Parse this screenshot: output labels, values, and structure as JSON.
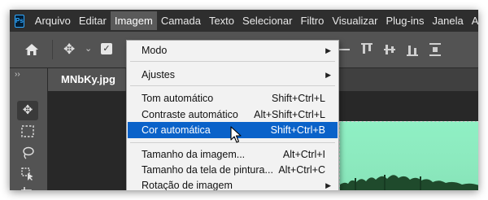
{
  "app": {
    "logo_text": "Ps"
  },
  "menubar": {
    "items": [
      "Arquivo",
      "Editar",
      "Imagem",
      "Camada",
      "Texto",
      "Selecionar",
      "Filtro",
      "Visualizar",
      "Plug-ins",
      "Janela",
      "Ajuda"
    ],
    "active_index": 2
  },
  "options_bar": {
    "checkbox_checked": true
  },
  "document": {
    "tab_title": "MNbKy.jpg"
  },
  "dropdown": {
    "items": [
      {
        "label": "Modo",
        "shortcut": "",
        "submenu": true
      },
      {
        "label": "Ajustes",
        "shortcut": "",
        "submenu": true
      },
      {
        "label": "Tom automático",
        "shortcut": "Shift+Ctrl+L",
        "submenu": false
      },
      {
        "label": "Contraste automático",
        "shortcut": "Alt+Shift+Ctrl+L",
        "submenu": false
      },
      {
        "label": "Cor automática",
        "shortcut": "Shift+Ctrl+B",
        "submenu": false,
        "highlighted": true
      },
      {
        "label": "Tamanho da imagem...",
        "shortcut": "Alt+Ctrl+I",
        "submenu": false
      },
      {
        "label": "Tamanho da tela de pintura...",
        "shortcut": "Alt+Ctrl+C",
        "submenu": false
      },
      {
        "label": "Rotação de imagem",
        "shortcut": "",
        "submenu": true
      }
    ]
  },
  "colors": {
    "menu_highlight": "#0a62c9",
    "photoshop_blue": "#31a8ff",
    "canvas_green": "#8ff0c4"
  }
}
